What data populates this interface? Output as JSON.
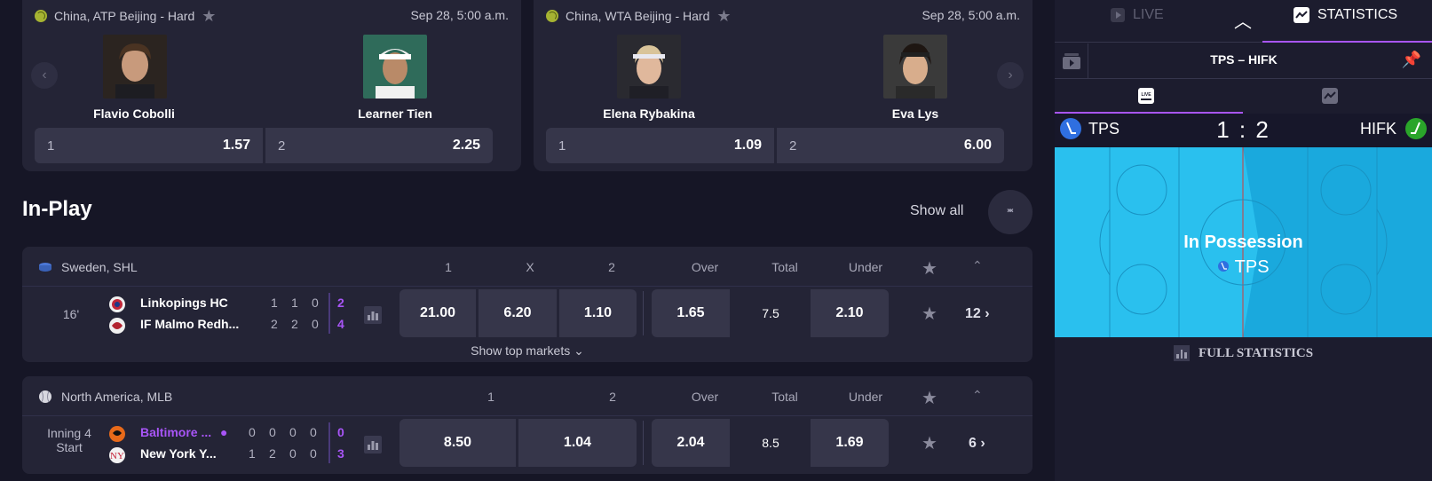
{
  "cards": [
    {
      "league": "China, ATP Beijing - Hard",
      "date": "Sep 28, 5:00 a.m.",
      "player1": "Flavio Cobolli",
      "player2": "Learner Tien",
      "odd1_label": "1",
      "odd1_value": "1.57",
      "odd2_label": "2",
      "odd2_value": "2.25"
    },
    {
      "league": "China, WTA Beijing - Hard",
      "date": "Sep 28, 5:00 a.m.",
      "player1": "Elena Rybakina",
      "player2": "Eva Lys",
      "odd1_label": "1",
      "odd1_value": "1.09",
      "odd2_label": "2",
      "odd2_value": "6.00"
    }
  ],
  "inplay": {
    "title": "In-Play",
    "show_all": "Show all"
  },
  "shl": {
    "league": "Sweden, SHL",
    "headers": [
      "1",
      "X",
      "2",
      "Over",
      "Total",
      "Under"
    ],
    "time": "16'",
    "team1": "Linkopings HC",
    "team2": "IF Malmo Redh...",
    "team1_periods": [
      "1",
      "1",
      "0"
    ],
    "team1_total": "2",
    "team2_periods": [
      "2",
      "2",
      "0"
    ],
    "team2_total": "4",
    "odds": [
      "21.00",
      "6.20",
      "1.10"
    ],
    "over": "1.65",
    "total": "7.5",
    "under": "2.10",
    "more": "12",
    "show_top": "Show top markets"
  },
  "mlb": {
    "league": "North America, MLB",
    "headers": [
      "1",
      "2",
      "Over",
      "Total",
      "Under"
    ],
    "time_line1": "Inning 4",
    "time_line2": "Start",
    "team1": "Baltimore ...",
    "team2": "New York Y...",
    "team1_innings": [
      "0",
      "0",
      "0",
      "0"
    ],
    "team1_total": "0",
    "team2_innings": [
      "1",
      "2",
      "0",
      "0"
    ],
    "team2_total": "3",
    "odds": [
      "8.50",
      "1.04"
    ],
    "over": "2.04",
    "total": "8.5",
    "under": "1.69",
    "more": "6"
  },
  "sidebar": {
    "tab_live": "LIVE",
    "tab_stats": "STATISTICS",
    "match_title": "TPS – HIFK",
    "home": "TPS",
    "away": "HIFK",
    "score": "1 : 2",
    "rink_caption": "In Possession",
    "rink_team": "TPS",
    "full_stats": "FULL STATISTICS",
    "home_color": "#2f6fe0",
    "away_color": "#2aa52a"
  }
}
